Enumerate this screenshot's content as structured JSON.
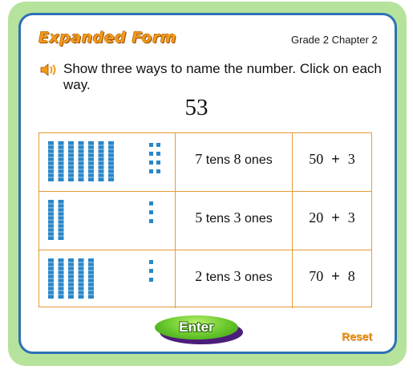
{
  "header": {
    "title": "Expanded Form",
    "grade_label": "Grade 2  Chapter 2"
  },
  "instruction": {
    "speaker_icon": "speaker-icon",
    "text": "Show three ways to name the number. Click on each way."
  },
  "target_number": "53",
  "rows": [
    {
      "blocks": {
        "tens": 7,
        "ones": 8
      },
      "tens_option": {
        "tens_value": "7",
        "tens_word": "tens",
        "ones_value": "8",
        "ones_word": "ones"
      },
      "sum_option": {
        "a": "50",
        "op": "+",
        "b": "3"
      }
    },
    {
      "blocks": {
        "tens": 2,
        "ones": 3
      },
      "tens_option": {
        "tens_value": "5",
        "tens_word": "tens",
        "ones_value": "3",
        "ones_word": "ones"
      },
      "sum_option": {
        "a": "20",
        "op": "+",
        "b": "3"
      }
    },
    {
      "blocks": {
        "tens": 5,
        "ones": 3
      },
      "tens_option": {
        "tens_value": "2",
        "tens_word": "tens",
        "ones_value": "3",
        "ones_word": "ones"
      },
      "sum_option": {
        "a": "70",
        "op": "+",
        "b": "8"
      }
    }
  ],
  "footer": {
    "enter_label": "Enter",
    "reset_label": "Reset"
  },
  "colors": {
    "frame": "#b6e39c",
    "panel_border": "#2f6fb6",
    "title_orange": "#f39a1b",
    "grid_border": "#e69a3a",
    "block_blue": "#2a86c8",
    "enter_green": "#66c62a"
  }
}
